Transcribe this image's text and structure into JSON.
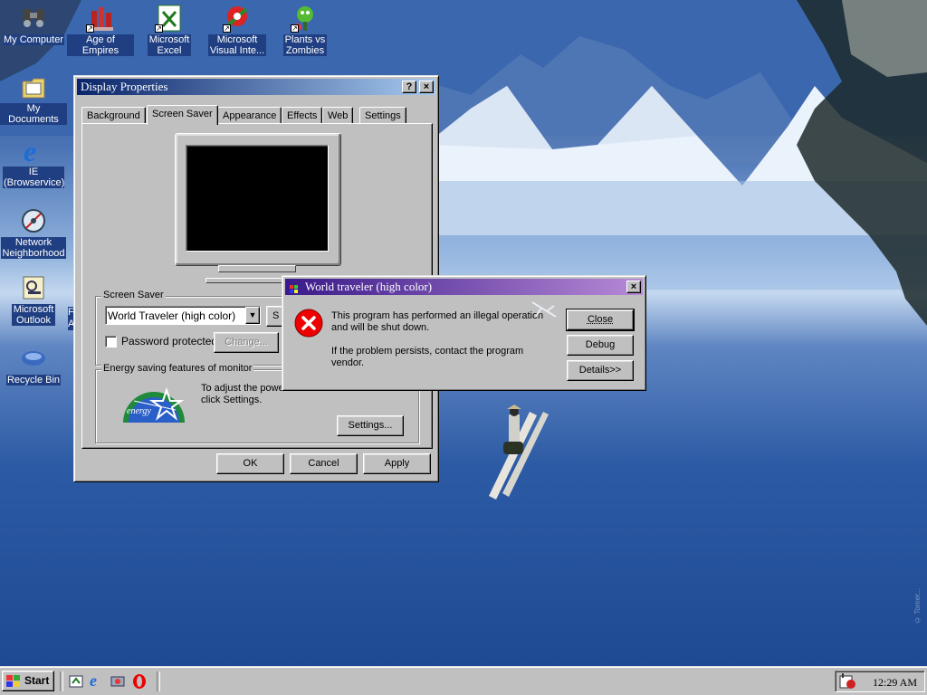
{
  "desktop": {
    "icons": [
      {
        "label": "My Computer",
        "icon": "my-computer-icon"
      },
      {
        "label": "Age of Empires",
        "icon": "age-of-empires-icon"
      },
      {
        "label": "Microsoft Excel",
        "icon": "excel-icon"
      },
      {
        "label": "Microsoft Visual Inte...",
        "icon": "visual-interdev-icon"
      },
      {
        "label": "Plants vs Zombies",
        "icon": "plants-vs-zombies-icon"
      },
      {
        "label": "My Documents",
        "icon": "my-documents-icon"
      },
      {
        "label": "IE (Browservice)",
        "icon": "internet-explorer-icon"
      },
      {
        "label": "Network Neighborhood",
        "icon": "network-neighborhood-icon"
      },
      {
        "label": "Microsoft Outlook",
        "icon": "outlook-icon"
      },
      {
        "label": "Recycle Bin",
        "icon": "recycle-bin-icon"
      }
    ],
    "copyright": "© Tomer..."
  },
  "display_properties": {
    "title": "Display Properties",
    "help_label": "?",
    "close_label": "×",
    "tabs": [
      "Background",
      "Screen Saver",
      "Appearance",
      "Effects",
      "Web",
      "Settings"
    ],
    "active_tab": "Screen Saver",
    "screensaver_group_label": "Screen Saver",
    "screensaver_selected": "World Traveler (high color)",
    "settings_btn_partial": "S",
    "password_label": "Password protected",
    "change_label": "Change...",
    "energy_group_label": "Energy saving features of monitor",
    "energy_text": "To adjust the power ... click Settings.",
    "energy_text_line1": "To adjust the powe",
    "energy_text_line2": "click Settings.",
    "energy_settings_label": "Settings...",
    "ok_label": "OK",
    "cancel_label": "Cancel",
    "apply_label": "Apply"
  },
  "error_dialog": {
    "title": "World traveler (high color)",
    "close_label": "×",
    "message_line1": "This program has performed an illegal operation",
    "message_line2": "and will be shut down.",
    "message_line3": "If the problem persists, contact the program",
    "message_line4": "vendor.",
    "close_btn": "Close",
    "debug_btn": "Debug",
    "details_btn": "Details>>",
    "icon": "error-icon"
  },
  "taskbar": {
    "start_label": "Start",
    "quick_launch": [
      "show-desktop-icon",
      "internet-explorer-icon",
      "channels-icon",
      "opera-icon"
    ],
    "clock": "12:29 AM"
  },
  "colors": {
    "title_active_start": "#0a246a",
    "title_active_end": "#a6caf0",
    "error_title_start": "#3a1a8a",
    "error_title_end": "#b78ad6",
    "desktop_label_bg": "#1f3f82"
  }
}
